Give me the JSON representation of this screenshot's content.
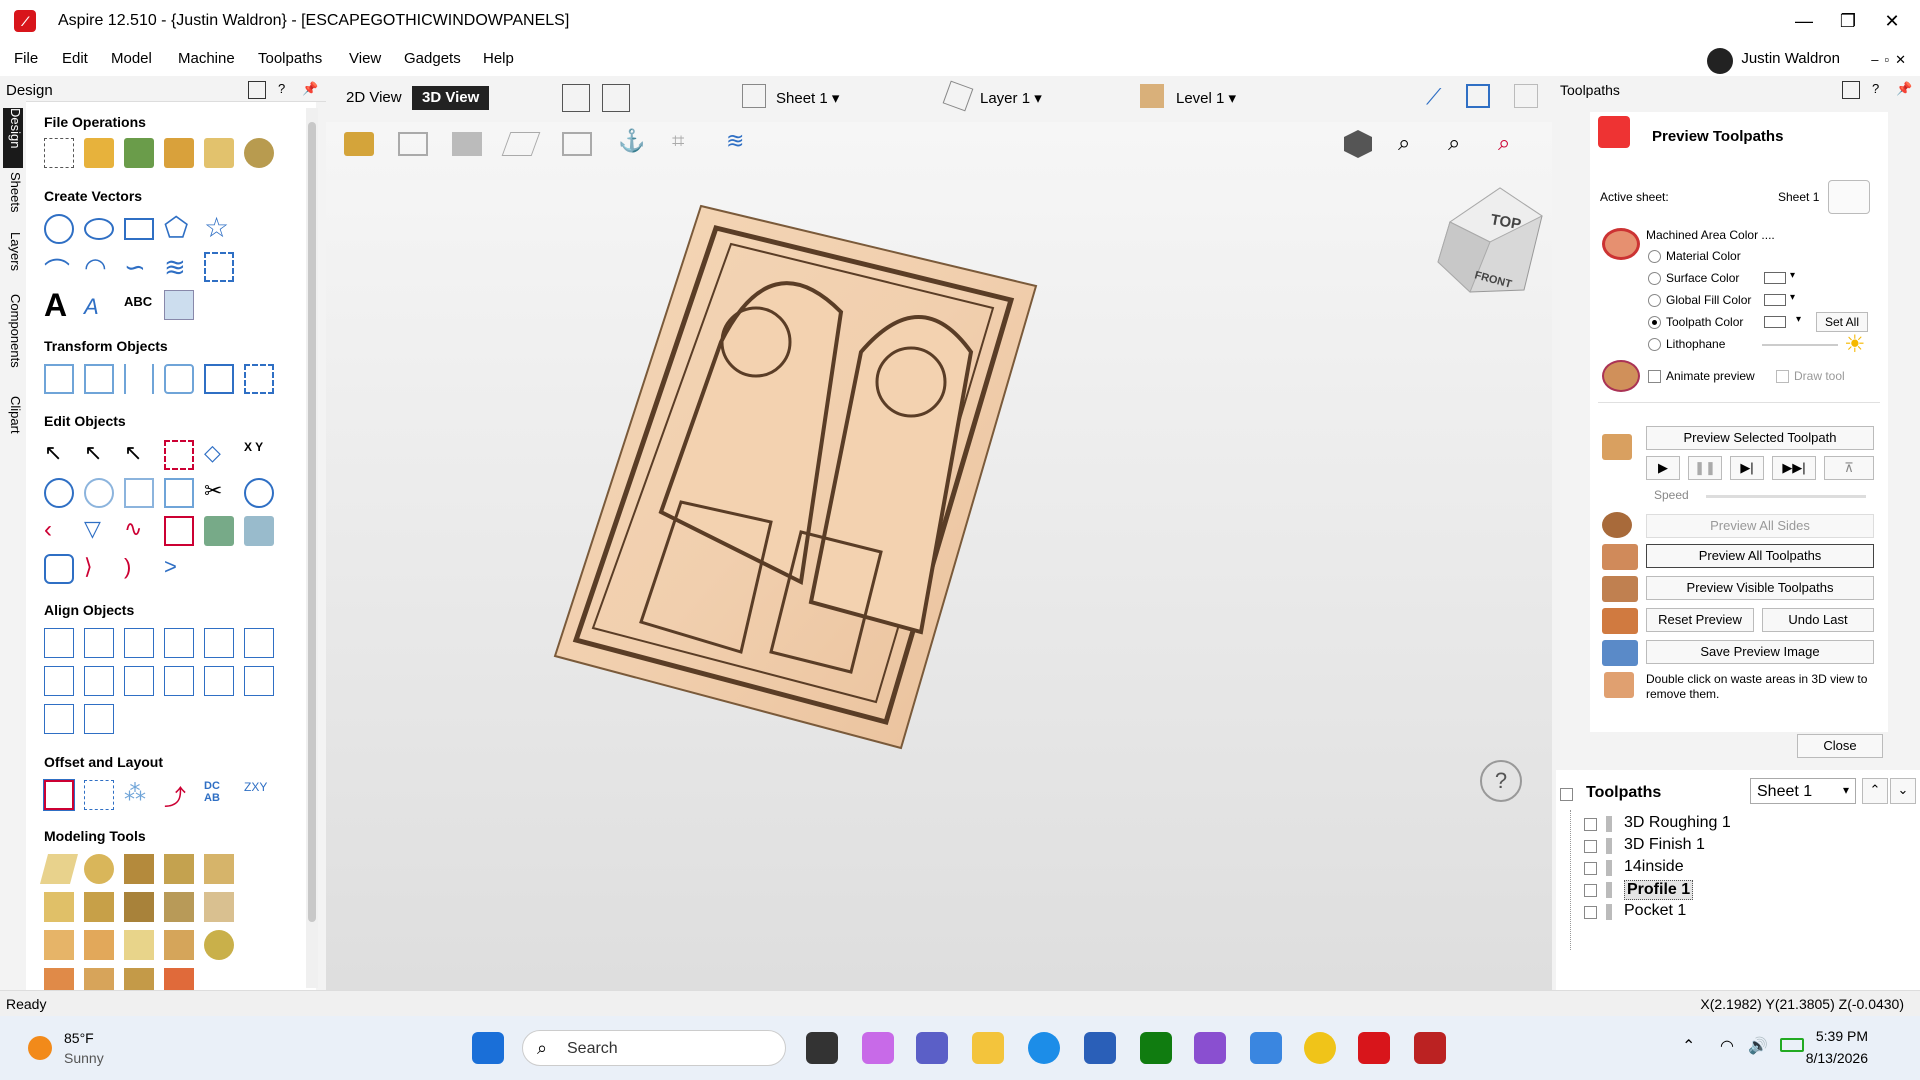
{
  "window": {
    "title": "Aspire 12.510 - {Justin Waldron} - [ESCAPEGOTHICWINDOWPANELS]"
  },
  "menu": [
    "File",
    "Edit",
    "Model",
    "Machine",
    "Toolpaths",
    "View",
    "Gadgets",
    "Help"
  ],
  "user": "Justin Waldron",
  "left_panel": {
    "title": "Design",
    "tabs": [
      "Design",
      "Sheets",
      "Layers",
      "Components",
      "Clipart"
    ],
    "sections": [
      "File Operations",
      "Create Vectors",
      "Transform Objects",
      "Edit Objects",
      "Align Objects",
      "Offset and Layout",
      "Modeling Tools"
    ]
  },
  "view": {
    "tab_2d": "2D View",
    "tab_3d": "3D View",
    "sheet": "Sheet 1",
    "layer": "Layer 1",
    "level": "Level 1",
    "cube_top": "TOP",
    "cube_front": "FRONT",
    "help": "?"
  },
  "right_panel": {
    "title": "Toolpaths",
    "preview_title": "Preview Toolpaths",
    "active_sheet_label": "Active sheet:",
    "active_sheet_value": "Sheet 1",
    "machined_area_label": "Machined Area Color ....",
    "color_options": [
      "Material Color",
      "Surface Color",
      "Global Fill Color",
      "Toolpath Color",
      "Lithophane"
    ],
    "selected_color_option": "Toolpath Color",
    "set_all": "Set All",
    "animate_preview": "Animate preview",
    "draw_tool": "Draw tool",
    "preview_selected": "Preview Selected Toolpath",
    "speed": "Speed",
    "preview_all_sides": "Preview All Sides",
    "preview_all": "Preview All Toolpaths",
    "preview_visible": "Preview Visible Toolpaths",
    "reset_preview": "Reset Preview",
    "undo_last": "Undo Last",
    "save_preview": "Save Preview Image",
    "hint": "Double click on waste areas in 3D view to remove them.",
    "close": "Close"
  },
  "toolpath_list": {
    "title": "Toolpaths",
    "sheet": "Sheet 1",
    "items": [
      "3D Roughing 1",
      "3D Finish 1",
      "14inside",
      "Profile 1",
      "Pocket 1"
    ],
    "selected": "Profile 1"
  },
  "status": {
    "text": "Ready",
    "coords": "X(2.1982) Y(21.3805) Z(-0.0430)"
  },
  "taskbar": {
    "weather_temp": "85°F",
    "weather_desc": "Sunny",
    "search": "Search",
    "time": "5:39 PM",
    "date": "8/13/2026"
  }
}
